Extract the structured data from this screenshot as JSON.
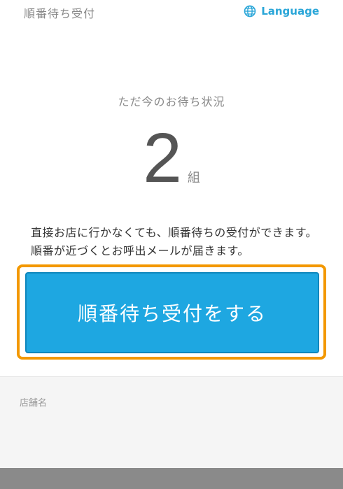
{
  "header": {
    "title": "順番待ち受付",
    "language_label": "Language"
  },
  "status": {
    "label": "ただ今のお待ち状況",
    "count": "2",
    "unit": "組"
  },
  "description": "直接お店に行かなくても、順番待ちの受付ができます。順番が近づくとお呼出メールが届きます。",
  "cta": {
    "label": "順番待ち受付をする"
  },
  "store": {
    "label": "店舗名"
  },
  "colors": {
    "accent": "#1ea7e1",
    "highlight": "#f39800",
    "link": "#2aa6d8"
  },
  "icons": {
    "language": "globe-icon"
  }
}
